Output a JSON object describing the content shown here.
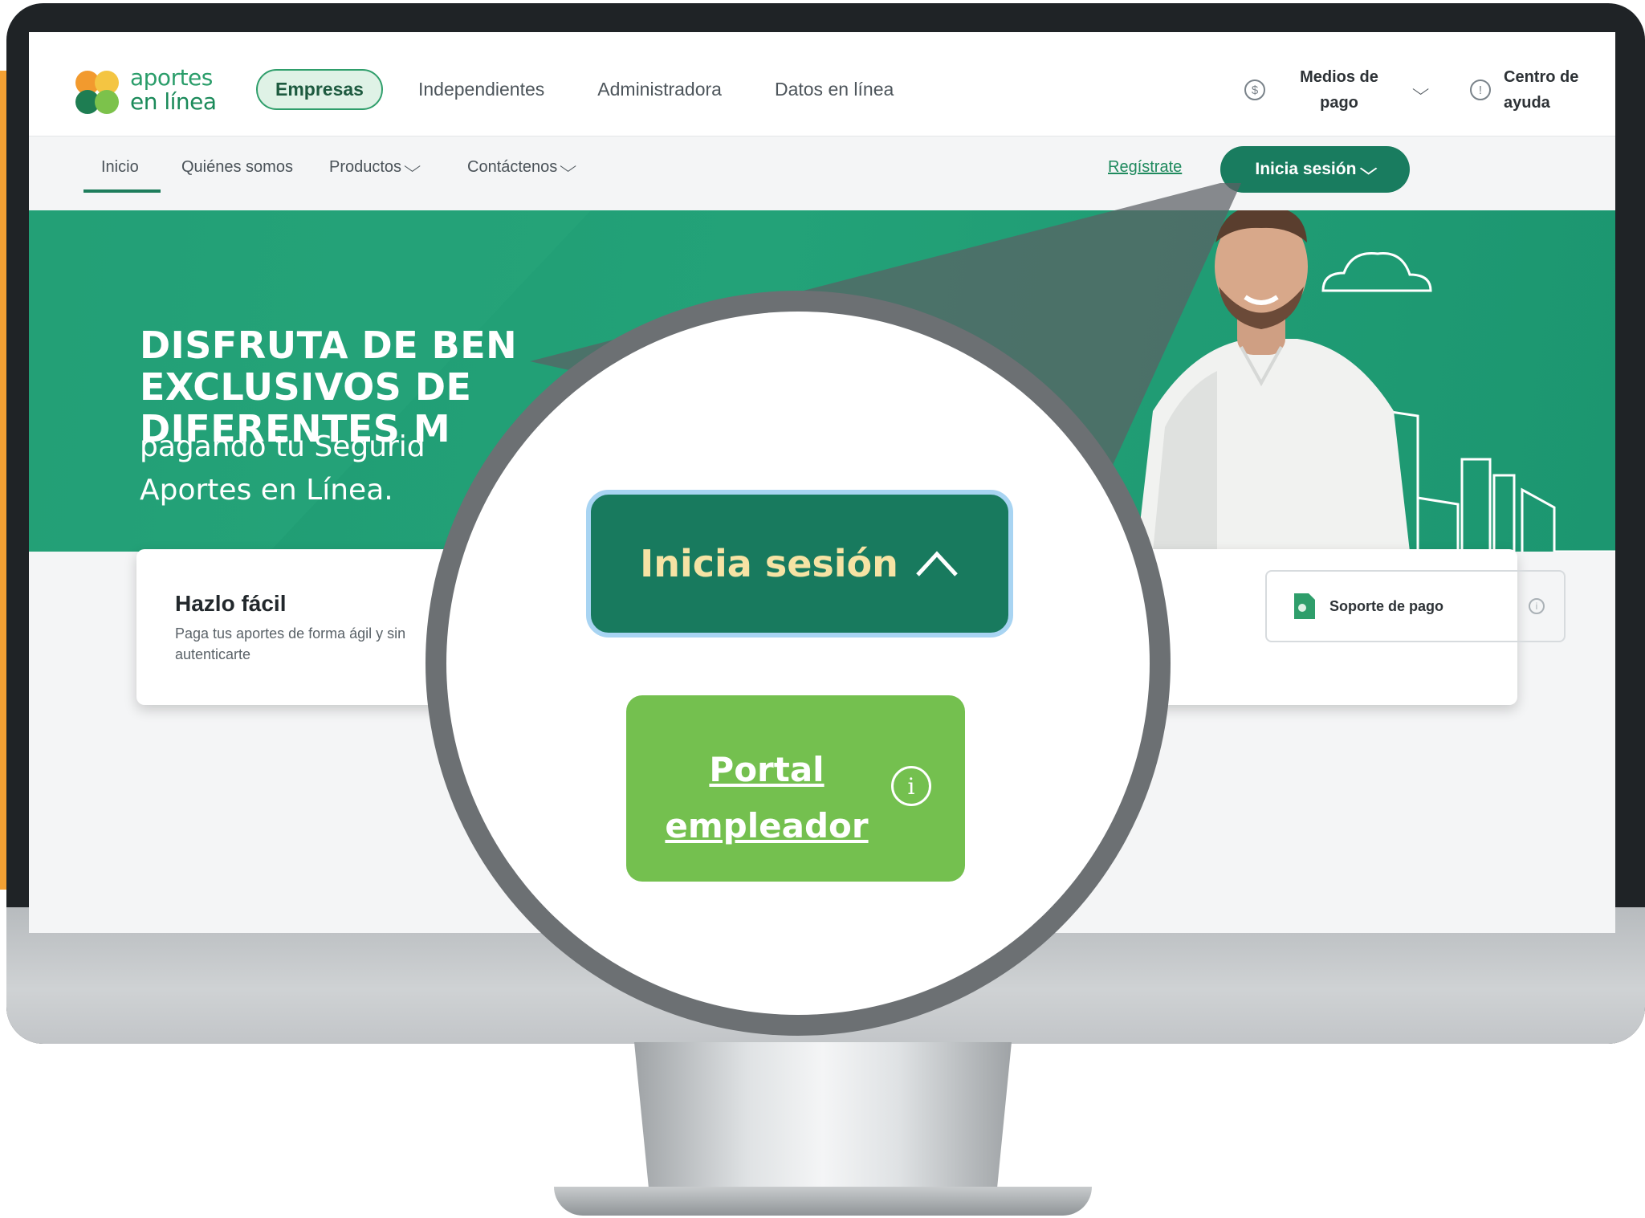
{
  "brand": {
    "logo_line1": "aportes",
    "logo_line2": "en línea",
    "colors": {
      "primary": "#197c5f",
      "accent_green": "#74c04f",
      "hero": "#22a077",
      "orange": "#f2a033"
    }
  },
  "top_tabs": [
    {
      "label": "Empresas",
      "active": true
    },
    {
      "label": "Independientes"
    },
    {
      "label": "Administradora"
    },
    {
      "label": "Datos en línea"
    }
  ],
  "top_right": {
    "payment_icon": "dollar-circle-icon",
    "payment_line1": "Medios de",
    "payment_line2": "pago",
    "help_icon": "info-circle-icon",
    "help_line1": "Centro de",
    "help_line2": "ayuda"
  },
  "nav": {
    "items": [
      "Inicio",
      "Quiénes somos",
      "Productos",
      "Contáctenos"
    ],
    "register": "Regístrate",
    "login": "Inicia sesión"
  },
  "hero": {
    "title_line1": "DISFRUTA DE BEN",
    "title_line2": "EXCLUSIVOS DE",
    "title_line3": "DIFERENTES M",
    "subtitle_line1": "pagando tu Segurid",
    "subtitle_line2": "Aportes en Línea."
  },
  "card": {
    "title": "Hazlo fácil",
    "desc_line1": "Paga tus aportes de forma ágil y sin",
    "desc_line2": "autenticarte",
    "support_label": "Soporte de pago"
  },
  "magnifier": {
    "login_label": "Inicia sesión",
    "portal_line1": "Portal",
    "portal_line2": "empleador"
  }
}
